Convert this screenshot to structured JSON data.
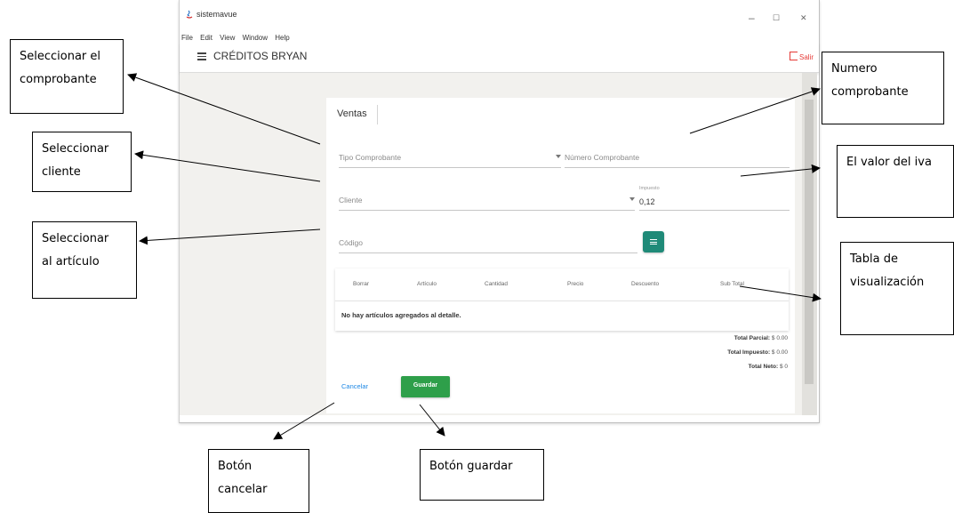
{
  "window": {
    "title": "sistemavue",
    "minimize": "–",
    "maximize": "☐",
    "close": "✕",
    "menu": [
      "File",
      "Edit",
      "View",
      "Window",
      "Help"
    ]
  },
  "toolbar": {
    "title": "CRÉDITOS BRYAN",
    "logout_label": "Salir"
  },
  "form": {
    "tab": "Ventas",
    "tipo_comprobante_placeholder": "Tipo Comprobante",
    "numero_comprobante_placeholder": "Número Comprobante",
    "cliente_placeholder": "Cliente",
    "impuesto_label": "Impuesto",
    "impuesto_value": "0,12",
    "codigo_placeholder": "Código"
  },
  "table": {
    "headers": [
      "Borrar",
      "Artículo",
      "Cantidad",
      "Precio",
      "Descuento",
      "Sub Total"
    ],
    "empty_message": "No hay artículos agregados al detalle."
  },
  "totals": {
    "parcial_label": "Total Parcial:",
    "parcial_value": "$ 0.00",
    "impuesto_label": "Total Impuesto:",
    "impuesto_value": "$ 0.00",
    "neto_label": "Total Neto:",
    "neto_value": "$ 0"
  },
  "actions": {
    "cancel_label": "Cancelar",
    "save_label": "Guardar"
  },
  "annotations": {
    "select_comprobante": "Seleccionar el\ncomprobante",
    "select_cliente": "Seleccionar\ncliente",
    "select_articulo": "Seleccionar\nal artículo",
    "numero_comprobante": "Numero\ncomprobante",
    "valor_iva": "El valor del iva",
    "tabla": "Tabla        de\nvisualización",
    "boton_cancelar": "Botón\ncancelar",
    "boton_guardar": "Botón guardar"
  },
  "colors": {
    "accent_teal": "#1f8a78",
    "save_green": "#2e9f4a",
    "cancel_blue": "#1e88e5",
    "logout_red": "#e53935"
  }
}
